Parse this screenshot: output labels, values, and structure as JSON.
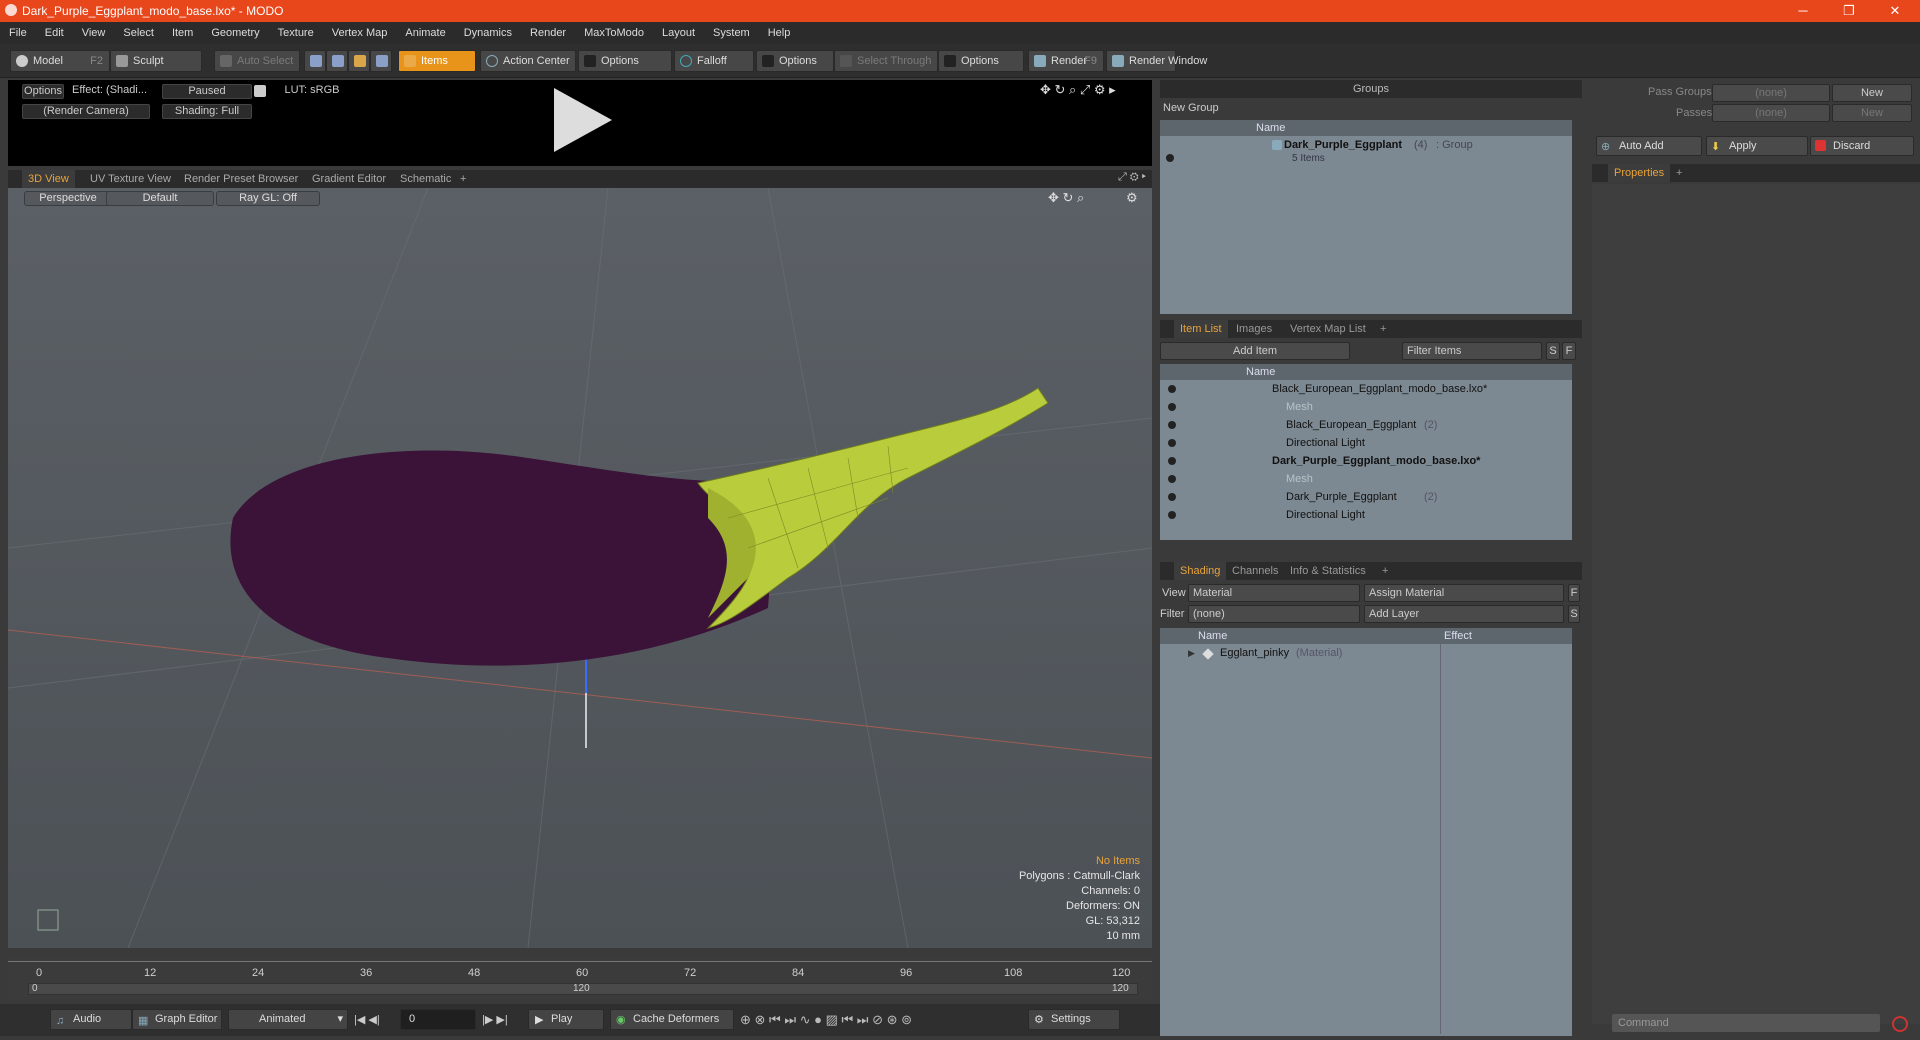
{
  "window": {
    "title": "Dark_Purple_Eggplant_modo_base.lxo* - MODO",
    "minimize": "─",
    "maximize": "❐",
    "close": "✕"
  },
  "menu": [
    "File",
    "Edit",
    "View",
    "Select",
    "Item",
    "Geometry",
    "Texture",
    "Vertex Map",
    "Animate",
    "Dynamics",
    "Render",
    "MaxToModo",
    "Layout",
    "System",
    "Help"
  ],
  "toolbar": {
    "model": "Model",
    "model_key": "F2",
    "sculpt": "Sculpt",
    "auto_select": "Auto Select",
    "items": "Items",
    "action_center": "Action Center",
    "options1": "Options",
    "falloff": "Falloff",
    "options2": "Options",
    "select_through": "Select Through",
    "options3": "Options",
    "render": "Render",
    "render_key": "F9",
    "render_window": "Render Window"
  },
  "preview": {
    "options": "Options",
    "effect": "Effect: (Shadi...",
    "paused": "Paused",
    "lut": "LUT: sRGB",
    "camera": "(Render Camera)",
    "shading": "Shading: Full"
  },
  "viewport_tabs": [
    "3D View",
    "UV Texture View",
    "Render Preset Browser",
    "Gradient Editor",
    "Schematic",
    "+"
  ],
  "viewport": {
    "perspective": "Perspective",
    "default": "Default",
    "raygl": "Ray GL: Off"
  },
  "stats": {
    "no_items": "No Items",
    "polygons": "Polygons : Catmull-Clark",
    "channels": "Channels: 0",
    "deformers": "Deformers: ON",
    "gl": "GL: 53,312",
    "scale": "10 mm"
  },
  "timeline": {
    "ticks": [
      "0",
      "12",
      "24",
      "36",
      "48",
      "60",
      "72",
      "84",
      "96",
      "108",
      "120"
    ],
    "sub_ticks": [
      "0",
      "120",
      "120"
    ]
  },
  "transport": {
    "audio": "Audio",
    "graph_editor": "Graph Editor",
    "animated": "Animated",
    "frame": "0",
    "play": "Play",
    "cache": "Cache Deformers",
    "settings": "Settings"
  },
  "groups": {
    "title": "Groups",
    "new_group": "New Group",
    "col_name": "Name",
    "item_name": "Dark_Purple_Eggplant",
    "item_count": "(4)",
    "item_type": ": Group",
    "item_sub": "5 Items"
  },
  "itemlist": {
    "tabs": [
      "Item List",
      "Images",
      "Vertex Map List",
      "+"
    ],
    "add_item": "Add Item",
    "filter": "Filter Items",
    "s": "S",
    "f": "F",
    "col_name": "Name",
    "rows": [
      {
        "label": "Black_European_Eggplant_modo_base.lxo*",
        "suffix": "",
        "bold": false,
        "indent": 0,
        "dim": false
      },
      {
        "label": "Mesh",
        "suffix": "",
        "bold": false,
        "indent": 2,
        "dim": true
      },
      {
        "label": "Black_European_Eggplant",
        "suffix": "(2)",
        "bold": false,
        "indent": 2,
        "dim": false
      },
      {
        "label": "Directional Light",
        "suffix": "",
        "bold": false,
        "indent": 2,
        "dim": false
      },
      {
        "label": "Dark_Purple_Eggplant_modo_base.lxo*",
        "suffix": "",
        "bold": true,
        "indent": 0,
        "dim": false
      },
      {
        "label": "Mesh",
        "suffix": "",
        "bold": false,
        "indent": 2,
        "dim": true
      },
      {
        "label": "Dark_Purple_Eggplant",
        "suffix": "(2)",
        "bold": false,
        "indent": 2,
        "dim": false
      },
      {
        "label": "Directional Light",
        "suffix": "",
        "bold": false,
        "indent": 2,
        "dim": false
      }
    ]
  },
  "shading": {
    "tabs": [
      "Shading",
      "Channels",
      "Info & Statistics",
      "+"
    ],
    "view_label": "View",
    "view_value": "Material",
    "assign": "Assign Material",
    "f": "F",
    "filter_label": "Filter",
    "filter_value": "(none)",
    "add_layer": "Add Layer",
    "s": "S",
    "col_name": "Name",
    "col_effect": "Effect",
    "material": "Egglant_pinky",
    "material_type": "(Material)"
  },
  "right": {
    "pass_groups": "Pass Groups",
    "passes": "Passes",
    "none1": "(none)",
    "none2": "(none)",
    "new1": "New",
    "new2": "New",
    "auto_add": "Auto Add",
    "apply": "Apply",
    "discard": "Discard",
    "properties": "Properties",
    "plus": "+",
    "command": "Command"
  }
}
